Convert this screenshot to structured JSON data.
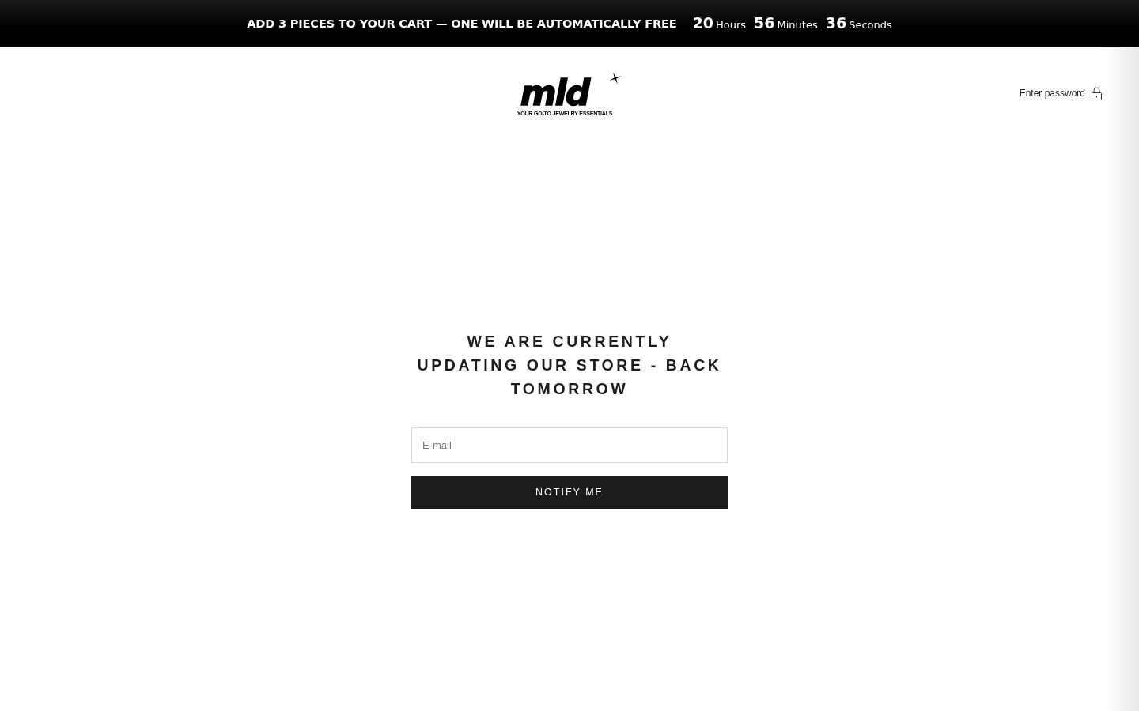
{
  "announcement": {
    "text": "ADD 3 PIECES TO YOUR CART — ONE WILL BE AUTOMATICALLY FREE",
    "countdown": [
      {
        "value": "20",
        "unit": "Hours"
      },
      {
        "value": "56",
        "unit": "Minutes"
      },
      {
        "value": "36",
        "unit": "Seconds"
      }
    ]
  },
  "header": {
    "logo": {
      "wordmark": "mld",
      "tagline": "YOUR GO-TO JEWELRY ESSENTIALS"
    },
    "password_link": {
      "label": "Enter password"
    }
  },
  "main": {
    "heading": "WE ARE CURRENTLY UPDATING OUR STORE - BACK TOMORROW",
    "email_field": {
      "placeholder": "E-mail"
    },
    "submit_button": {
      "label": "NOTIFY ME"
    }
  }
}
